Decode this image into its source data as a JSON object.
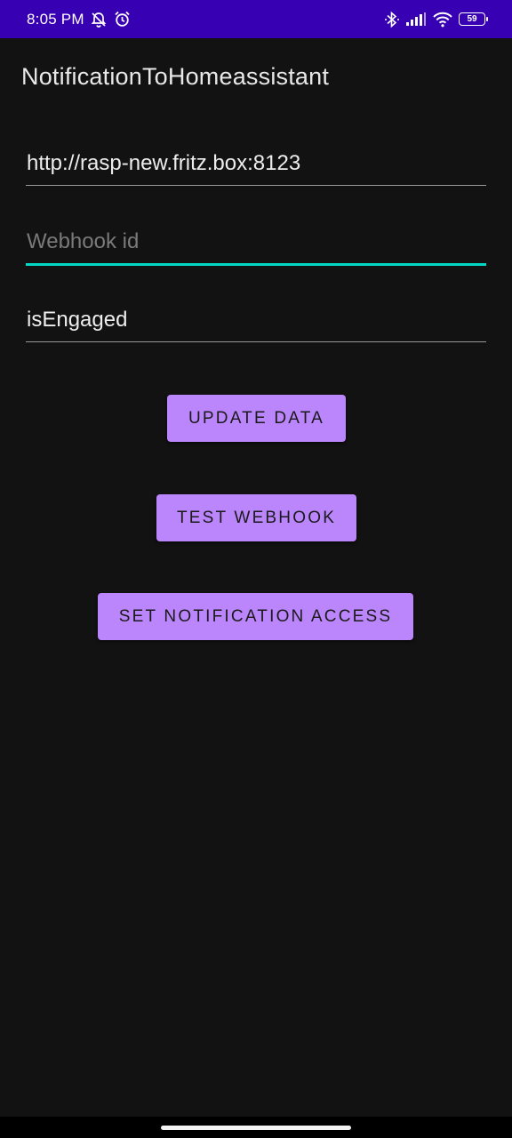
{
  "status_bar": {
    "time": "8:05 PM",
    "battery": "59",
    "icons": [
      "muted-bell-icon",
      "alarm-icon",
      "bluetooth-icon",
      "signal-icon",
      "wifi-icon",
      "battery-icon"
    ]
  },
  "app_bar": {
    "title": "NotificationToHomeassistant"
  },
  "form": {
    "url": {
      "value": "http://rasp-new.fritz.box:8123",
      "placeholder": ""
    },
    "webhook": {
      "value": "",
      "placeholder": "Webhook id"
    },
    "status_field": {
      "value": "isEngaged",
      "placeholder": ""
    }
  },
  "buttons": {
    "update": "UPDATE DATA",
    "test": "TEST WEBHOOK",
    "notification_access": "SET NOTIFICATION ACCESS"
  },
  "colors": {
    "status_bar": "#3700b3",
    "background": "#121212",
    "button": "#bb86fc",
    "focus_underline": "#03dac5"
  }
}
